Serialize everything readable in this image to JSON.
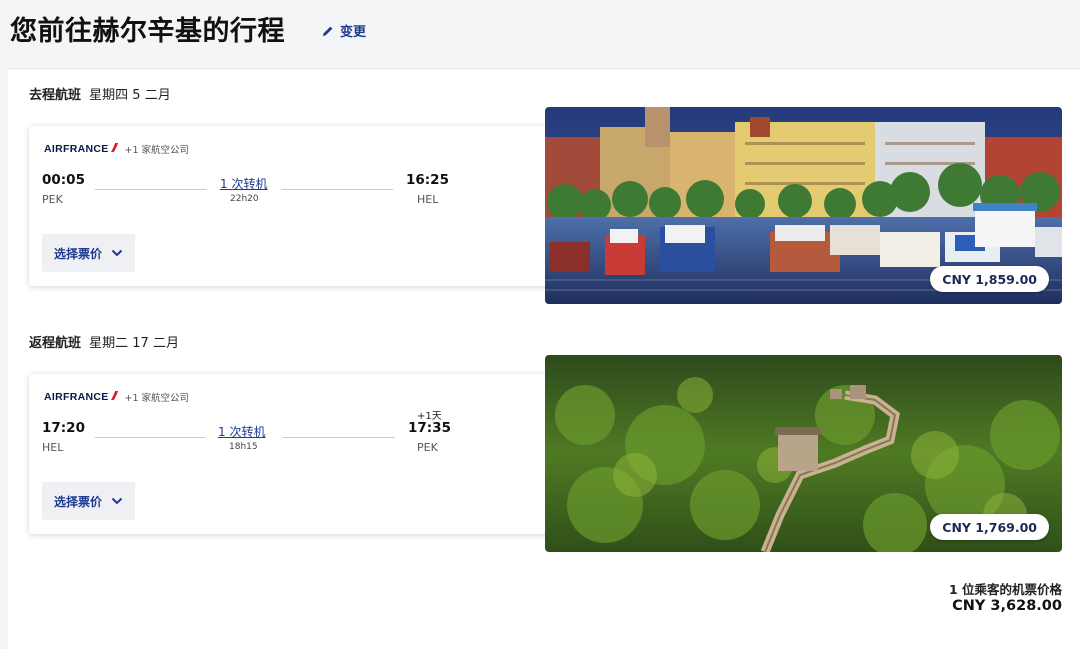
{
  "header": {
    "title": "您前往赫尔辛基的行程",
    "edit_label": "变更"
  },
  "outbound": {
    "heading_label": "去程航班",
    "heading_date": "星期四 5 二月",
    "airline_logo": "AIRFRANCE",
    "partners": "+1 家航空公司",
    "depart_time": "00:05",
    "depart_code": "PEK",
    "stops": "1 次转机",
    "duration": "22h20",
    "arrive_time": "16:25",
    "arrive_code": "HEL",
    "arrive_day_offset": "",
    "fare_button": "选择票价",
    "price": "CNY 1,859.00",
    "photo": "helsinki-harbor-photo"
  },
  "return": {
    "heading_label": "返程航班",
    "heading_date": "星期二 17 二月",
    "airline_logo": "AIRFRANCE",
    "partners": "+1 家航空公司",
    "depart_time": "17:20",
    "depart_code": "HEL",
    "stops": "1 次转机",
    "duration": "18h15",
    "arrive_time": "17:35",
    "arrive_code": "PEK",
    "arrive_day_offset": "+1天",
    "fare_button": "选择票价",
    "price": "CNY 1,769.00",
    "photo": "great-wall-photo"
  },
  "total": {
    "label": "1 位乘客的机票价格",
    "value": "CNY 3,628.00"
  },
  "colors": {
    "brand_blue": "#1f3a8f",
    "airfrance_red": "#e0202b",
    "background": "#f4f5f7"
  },
  "icons": [
    "pencil-icon",
    "chevron-down-icon"
  ]
}
